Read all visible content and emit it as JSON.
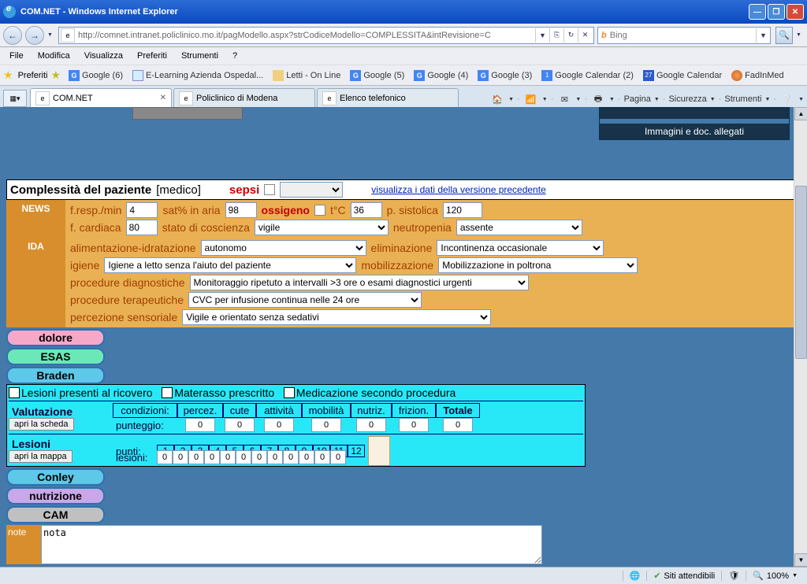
{
  "window": {
    "title": "COM.NET - Windows Internet Explorer"
  },
  "addressbar": {
    "url": "http://comnet.intranet.policlinico.mo.it/pagModello.aspx?strCodiceModello=COMPLESSITA&intRevisione=C"
  },
  "search": {
    "engine": "Bing",
    "placeholder": ""
  },
  "menu": {
    "file": "File",
    "modifica": "Modifica",
    "visualizza": "Visualizza",
    "preferiti": "Preferiti",
    "strumenti": "Strumenti",
    "help": "?"
  },
  "favorites": {
    "label": "Preferiti",
    "items": [
      "Google (6)",
      "E-Learning Azienda Ospedal...",
      "Letti - On Line",
      "Google (5)",
      "Google (4)",
      "Google (3)",
      "Google Calendar (2)",
      "Google Calendar",
      "FadInMed"
    ]
  },
  "tabs": {
    "t1": "COM.NET",
    "t2": "Policlinico di Modena",
    "t3": "Elenco telefonico"
  },
  "toolbar": {
    "pagina": "Pagina",
    "sicurezza": "Sicurezza",
    "strumenti": "Strumenti"
  },
  "banner": "Immagini e doc. allegati",
  "form": {
    "title": "Complessità del paziente",
    "role": "[medico]",
    "sepsi": "sepsi",
    "link": "visualizza i dati della versione precedente",
    "news": {
      "label": "NEWS",
      "fresp": "f.resp./min",
      "fresp_val": "4",
      "sat": "sat% in aria",
      "sat_val": "98",
      "ossigeno": "ossigeno",
      "tc": "t°C",
      "tc_val": "36",
      "psist": "p. sistolica",
      "psist_val": "120",
      "fcard": "f. cardiaca",
      "fcard_val": "80",
      "coscienza": "stato di coscienza",
      "coscienza_val": "vigile",
      "neutro": "neutropenia",
      "neutro_val": "assente"
    },
    "ida": {
      "label": "IDA",
      "alim": "alimentazione-idratazione",
      "alim_val": "autonomo",
      "elim": "eliminazione",
      "elim_val": "Incontinenza occasionale",
      "igiene": "igiene",
      "igiene_val": "Igiene a letto senza l'aiuto del paziente",
      "mobil": "mobilizzazione",
      "mobil_val": "Mobilizzazione in poltrona",
      "procdiag": "procedure diagnostiche",
      "procdiag_val": "Monitoraggio ripetuto a intervalli >3 ore o esami diagnostici urgenti",
      "procter": "procedure terapeutiche",
      "procter_val": "CVC per infusione continua nelle 24 ore",
      "percez": "percezione sensoriale",
      "percez_val": "Vigile e orientato senza sedativi"
    }
  },
  "tags": {
    "dolore": "dolore",
    "esas": "ESAS",
    "braden": "Braden",
    "conley": "Conley",
    "nutrizione": "nutrizione",
    "cam": "CAM"
  },
  "braden": {
    "les_ricovero": "Lesioni presenti al ricovero",
    "materasso": "Materasso prescritto",
    "medicazione": "Medicazione secondo procedura",
    "valutazione": "Valutazione",
    "apri_scheda": "apri la scheda",
    "cond": "condizioni:",
    "percez": "percez.",
    "cute": "cute",
    "attivita": "attività",
    "mobilita": "mobilità",
    "nutriz": "nutriz.",
    "frizion": "frizion.",
    "totale": "Totale",
    "punteggio": "punteggio:",
    "p1": "0",
    "p2": "0",
    "p3": "0",
    "p4": "0",
    "p5": "0",
    "p6": "0",
    "ptot": "0",
    "lesioni": "Lesioni",
    "apri_mappa": "apri la mappa",
    "punti": "punti:",
    "les_lbl": "lesioni:",
    "n1": "1",
    "n2": "2",
    "n3": "3",
    "n4": "4",
    "n5": "5",
    "n6": "6",
    "n7": "7",
    "n8": "8",
    "n9": "9",
    "n10": "10",
    "n11": "11",
    "n12": "12",
    "l1": "0",
    "l2": "0",
    "l3": "0",
    "l4": "0",
    "l5": "0",
    "l6": "0",
    "l7": "0",
    "l8": "0",
    "l9": "0",
    "l10": "0",
    "l11": "0",
    "l12": "0"
  },
  "note": {
    "label": "note",
    "value": "nota"
  },
  "status": {
    "siti": "Siti attendibili",
    "zoom": "100%"
  }
}
